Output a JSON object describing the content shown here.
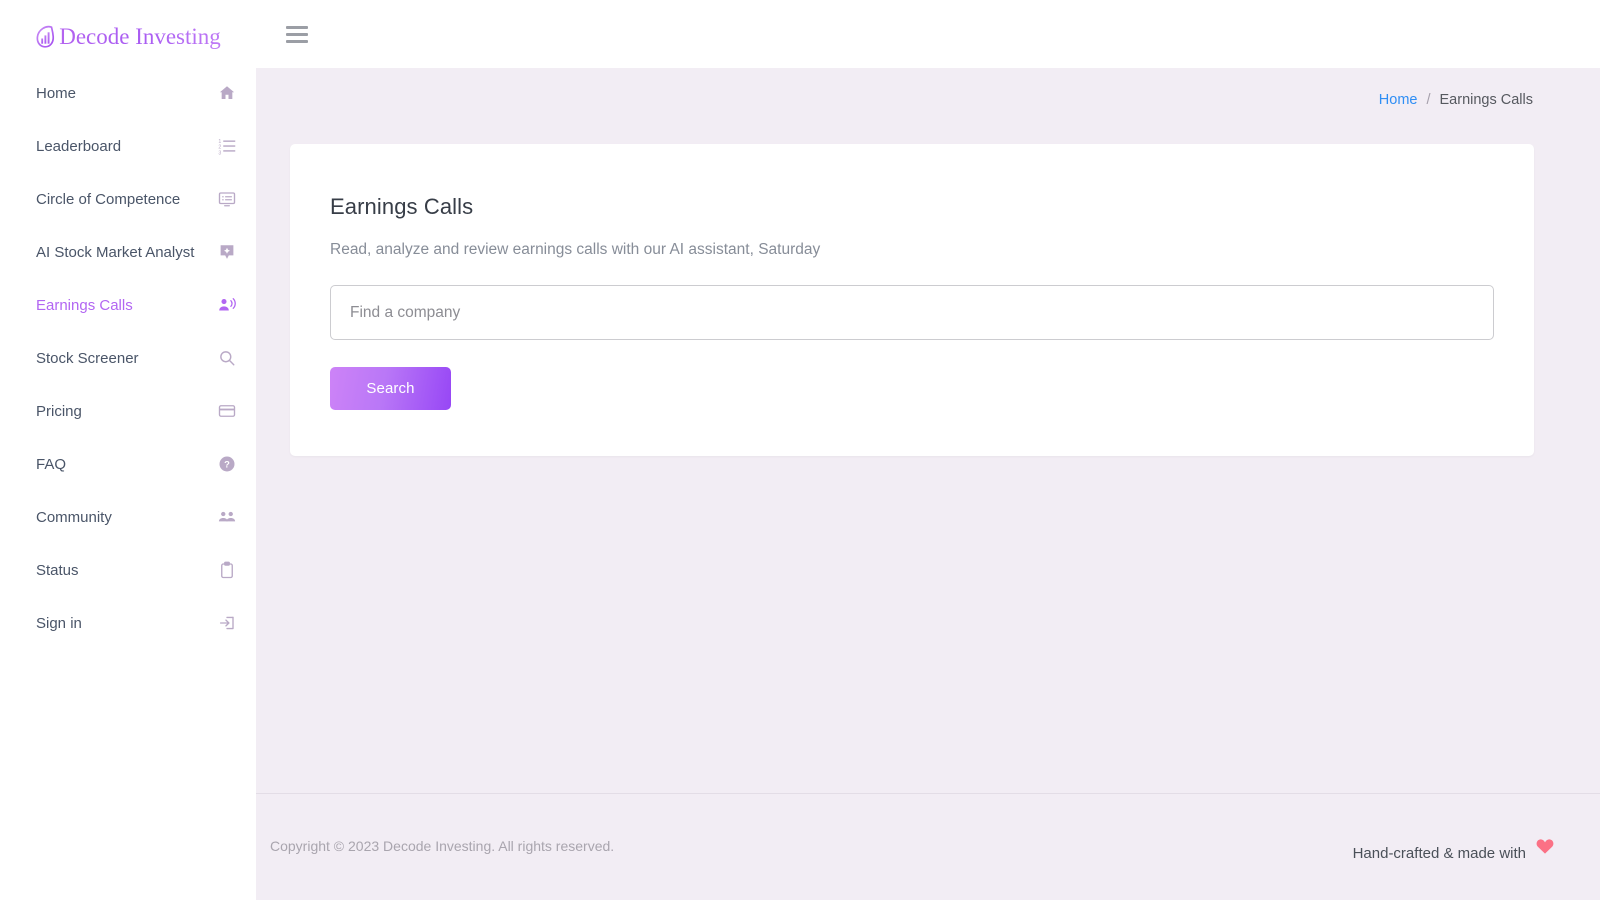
{
  "brand": {
    "name": "Decode Investing",
    "logo_icon": "chart-leaf-logo-icon",
    "accent_color": "#b266f2"
  },
  "topbar": {
    "menu_icon": "hamburger-menu-icon"
  },
  "sidebar": {
    "items": [
      {
        "label": "Home",
        "icon": "home-icon",
        "active": false
      },
      {
        "label": "Leaderboard",
        "icon": "ordered-list-icon",
        "active": false
      },
      {
        "label": "Circle of Competence",
        "icon": "web-card-icon",
        "active": false
      },
      {
        "label": "AI Stock Market Analyst",
        "icon": "sparkle-badge-icon",
        "active": false
      },
      {
        "label": "Earnings Calls",
        "icon": "person-speaking-icon",
        "active": true
      },
      {
        "label": "Stock Screener",
        "icon": "search-icon",
        "active": false
      },
      {
        "label": "Pricing",
        "icon": "credit-card-icon",
        "active": false
      },
      {
        "label": "FAQ",
        "icon": "help-circle-icon",
        "active": false
      },
      {
        "label": "Community",
        "icon": "people-group-icon",
        "active": false
      },
      {
        "label": "Status",
        "icon": "clipboard-icon",
        "active": false
      },
      {
        "label": "Sign in",
        "icon": "login-arrow-icon",
        "active": false
      }
    ]
  },
  "breadcrumb": {
    "home_label": "Home",
    "separator": "/",
    "current_label": "Earnings Calls",
    "link_color": "#2f8ef4"
  },
  "main": {
    "title": "Earnings Calls",
    "subtitle": "Read, analyze and review earnings calls with our AI assistant, Saturday",
    "search": {
      "placeholder": "Find a company",
      "value": ""
    },
    "search_button_label": "Search"
  },
  "footer": {
    "copyright": "Copyright © 2023 Decode Investing. All rights reserved.",
    "handcrafted_text": "Hand-crafted & made with",
    "heart_icon": "heart-icon",
    "heart_color": "#fb7185"
  }
}
